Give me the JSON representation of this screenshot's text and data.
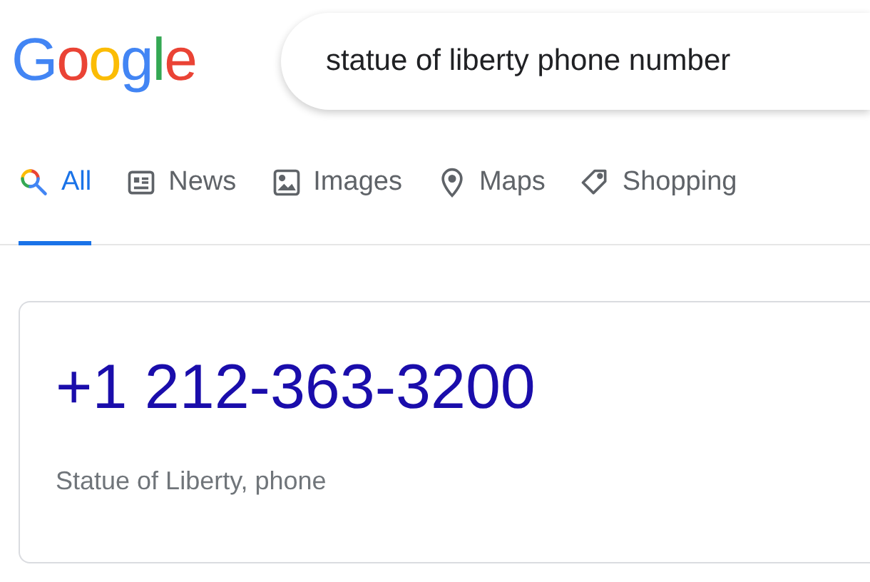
{
  "logo": "Google",
  "search": {
    "value": "statue of liberty phone number"
  },
  "tabs": [
    {
      "label": "All",
      "kind": "all",
      "selected": true
    },
    {
      "label": "News",
      "kind": "news",
      "selected": false
    },
    {
      "label": "Images",
      "kind": "images",
      "selected": false
    },
    {
      "label": "Maps",
      "kind": "maps",
      "selected": false
    },
    {
      "label": "Shopping",
      "kind": "shopping",
      "selected": false
    }
  ],
  "result": {
    "phone": "+1 212-363-3200",
    "caption": "Statue of Liberty, phone"
  }
}
